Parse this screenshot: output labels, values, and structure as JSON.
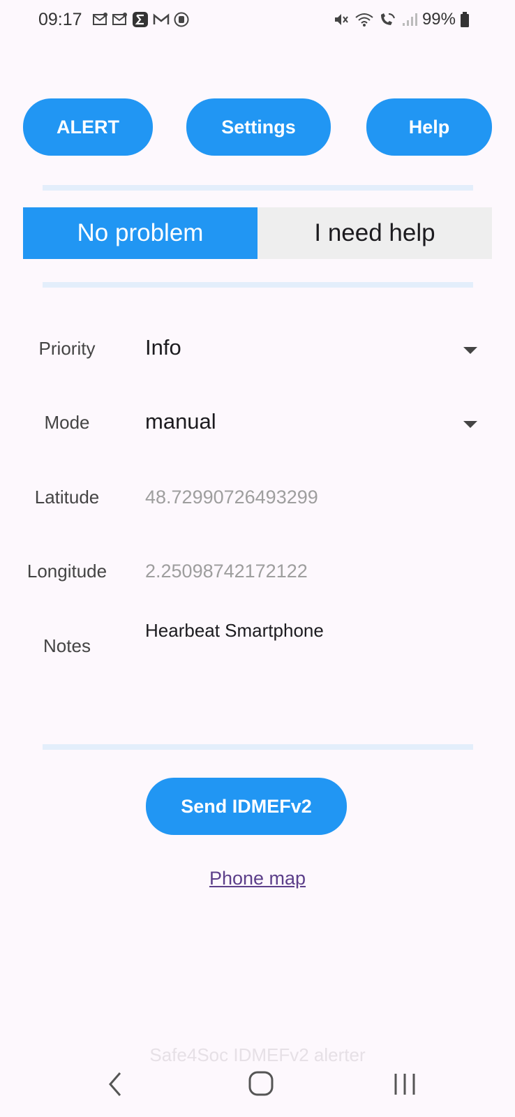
{
  "status_bar": {
    "time": "09:17",
    "battery": "99%"
  },
  "top_buttons": {
    "alert": "ALERT",
    "settings": "Settings",
    "help": "Help"
  },
  "status_toggle": {
    "option_1": "No problem",
    "option_2": "I need help",
    "selected": "No problem"
  },
  "form": {
    "priority_label": "Priority",
    "priority_value": "Info",
    "mode_label": "Mode",
    "mode_value": "manual",
    "latitude_label": "Latitude",
    "latitude_value": "48.72990726493299",
    "longitude_label": "Longitude",
    "longitude_value": "2.25098742172122",
    "notes_label": "Notes",
    "notes_value": "Hearbeat Smartphone"
  },
  "actions": {
    "send": "Send IDMEFv2",
    "phone_map": "Phone map"
  },
  "footer": {
    "app_name": "Safe4Soc IDMEFv2 alerter"
  },
  "colors": {
    "accent": "#2196f3",
    "link": "#5c3f8a",
    "background": "#fdf8fd"
  }
}
